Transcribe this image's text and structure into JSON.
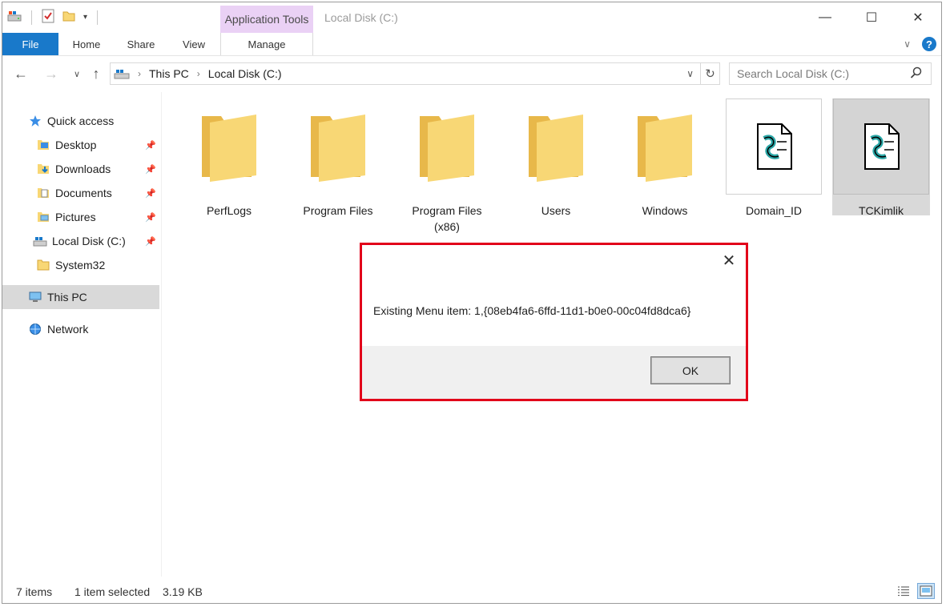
{
  "window": {
    "title": "Local Disk (C:)",
    "context_tab_header": "Application Tools"
  },
  "ribbon": {
    "tabs": [
      "File",
      "Home",
      "Share",
      "View",
      "Manage"
    ],
    "help": "?"
  },
  "address": {
    "crumbs": [
      "This PC",
      "Local Disk (C:)"
    ]
  },
  "search": {
    "placeholder": "Search Local Disk (C:)"
  },
  "nav": {
    "quick_access": "Quick access",
    "pinned": [
      "Desktop",
      "Downloads",
      "Documents",
      "Pictures",
      "Local Disk (C:)"
    ],
    "system32": "System32",
    "this_pc": "This PC",
    "network": "Network"
  },
  "items": [
    {
      "name": "PerfLogs",
      "type": "folder"
    },
    {
      "name": "Program Files",
      "type": "folder"
    },
    {
      "name": "Program Files (x86)",
      "type": "folder"
    },
    {
      "name": "Users",
      "type": "folder"
    },
    {
      "name": "Windows",
      "type": "folder"
    },
    {
      "name": "Domain_ID",
      "type": "script"
    },
    {
      "name": "TCKimlik",
      "type": "script"
    }
  ],
  "dialog": {
    "message": "Existing Menu item: 1,{08eb4fa6-6ffd-11d1-b0e0-00c04fd8dca6}",
    "ok_label": "OK"
  },
  "status": {
    "item_count": "7 items",
    "selection": "1 item selected",
    "size": "3.19 KB"
  },
  "colors": {
    "accent": "#1979ca",
    "context_tab": "#ead1f5",
    "dialog_highlight": "#e2001a",
    "folder": "#f8d775"
  }
}
